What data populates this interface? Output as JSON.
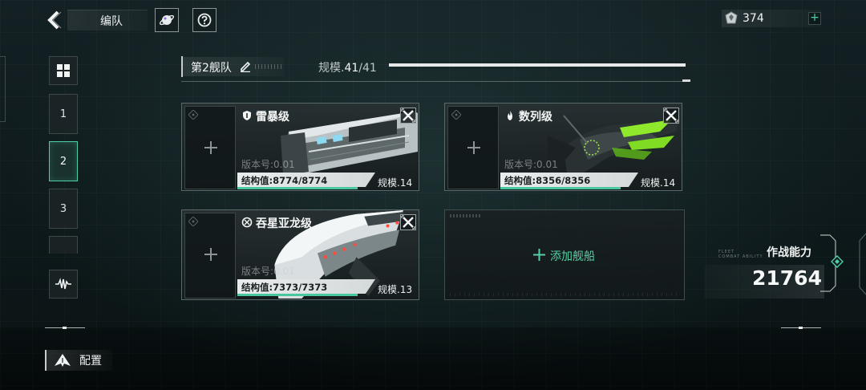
{
  "header": {
    "title": "编队",
    "icons": [
      "back-arrow-icon",
      "planet-icon",
      "help-icon"
    ]
  },
  "currency": {
    "value": "374",
    "icon": "crystal-icon",
    "add_label": "+"
  },
  "sidebar": {
    "items": [
      {
        "label": "",
        "icon": "grid-icon"
      },
      {
        "label": "1"
      },
      {
        "label": "2",
        "active": true
      },
      {
        "label": "3"
      },
      {
        "label": "",
        "icon": "waveform-icon"
      }
    ]
  },
  "fleet": {
    "name": "第2舰队",
    "scale_label": "规模.",
    "scale_current": "41",
    "scale_max": "/41",
    "scale_fraction": 1.0
  },
  "ships": [
    {
      "class_name": "雷暴级",
      "class_icon": "shield-icon",
      "version": "版本号:0.01",
      "hp": "结构值:8774/8774",
      "hp_fraction": 1.0,
      "scale": "规模.14"
    },
    {
      "class_name": "数列级",
      "class_icon": "flame-icon",
      "version": "版本号:0.01",
      "hp": "结构值:8356/8356",
      "hp_fraction": 1.0,
      "scale": "规模.14"
    },
    {
      "class_name": "吞星亚龙级",
      "class_icon": "target-icon",
      "version": "版本号:0.01",
      "hp": "结构值:7373/7373",
      "hp_fraction": 1.0,
      "scale": "规模.13"
    }
  ],
  "add_ship": {
    "label": "添加舰船"
  },
  "combat": {
    "label": "作战能力",
    "value": "21764",
    "caption_line1": "FLEET",
    "caption_line2": "COMBAT ABILITY"
  },
  "config": {
    "label": "配置"
  },
  "colors": {
    "accent": "#4fcfa6",
    "panel_border": "#59696a",
    "text": "#e6e9ea"
  }
}
